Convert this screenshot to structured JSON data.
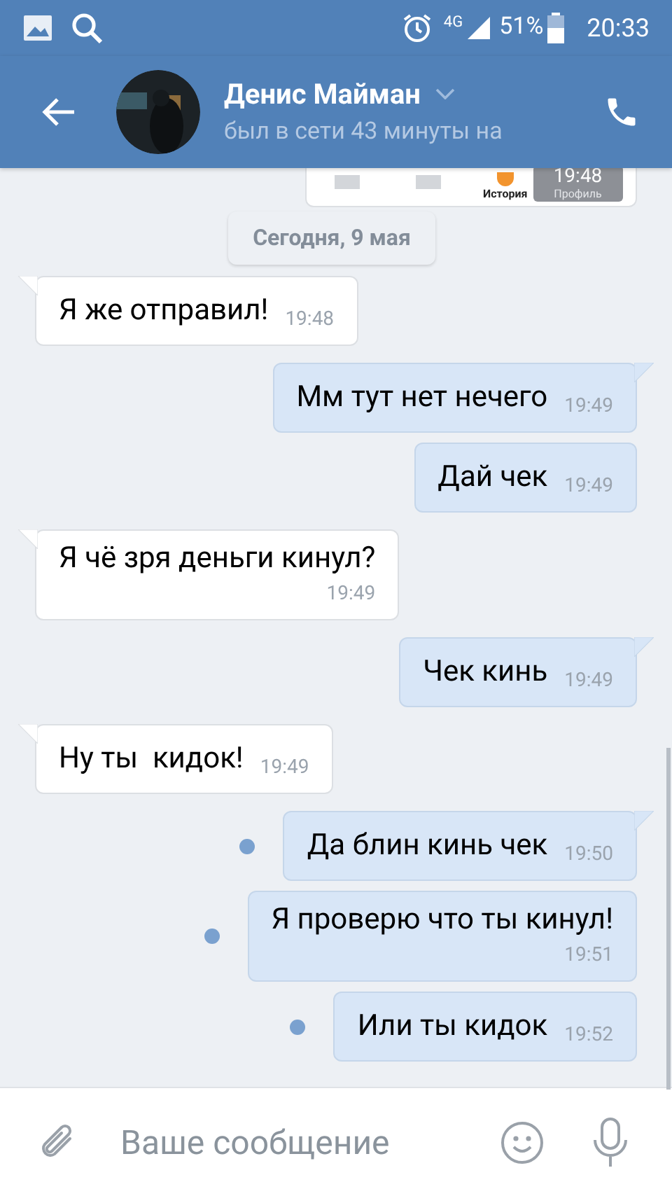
{
  "status_bar": {
    "network": "4G",
    "battery": "51%",
    "time": "20:33"
  },
  "header": {
    "name": "Денис Майман",
    "status": "был в сети 43 минуты на"
  },
  "attachment_preview": {
    "labels": [
      "История",
      "Профиль"
    ],
    "time": "19:48"
  },
  "date_divider": "Сегодня, 9 мая",
  "messages": [
    {
      "kind": "incoming",
      "text": "Я же отправил!",
      "time": "19:48",
      "tail": true,
      "unread": false,
      "wrapped": false
    },
    {
      "kind": "outgoing",
      "text": "Мм тут нет нечего",
      "time": "19:49",
      "tail": true,
      "unread": false,
      "wrapped": false
    },
    {
      "kind": "outgoing",
      "text": "Дай чек",
      "time": "19:49",
      "tail": false,
      "unread": false,
      "wrapped": false
    },
    {
      "kind": "incoming",
      "text": "Я чё зря деньги кинул?",
      "time": "19:49",
      "tail": true,
      "unread": false,
      "wrapped": true
    },
    {
      "kind": "outgoing",
      "text": "Чек кинь",
      "time": "19:49",
      "tail": true,
      "unread": false,
      "wrapped": false
    },
    {
      "kind": "incoming",
      "text": "Ну ты  кидок!",
      "time": "19:49",
      "tail": true,
      "unread": false,
      "wrapped": false
    },
    {
      "kind": "outgoing",
      "text": "Да блин кинь чек",
      "time": "19:50",
      "tail": true,
      "unread": true,
      "wrapped": false
    },
    {
      "kind": "outgoing",
      "text": "Я проверю что ты кинул!",
      "time": "19:51",
      "tail": false,
      "unread": true,
      "wrapped": true
    },
    {
      "kind": "outgoing",
      "text": "Или ты кидок",
      "time": "19:52",
      "tail": false,
      "unread": true,
      "wrapped": false
    }
  ],
  "composer": {
    "placeholder": "Ваше сообщение"
  }
}
